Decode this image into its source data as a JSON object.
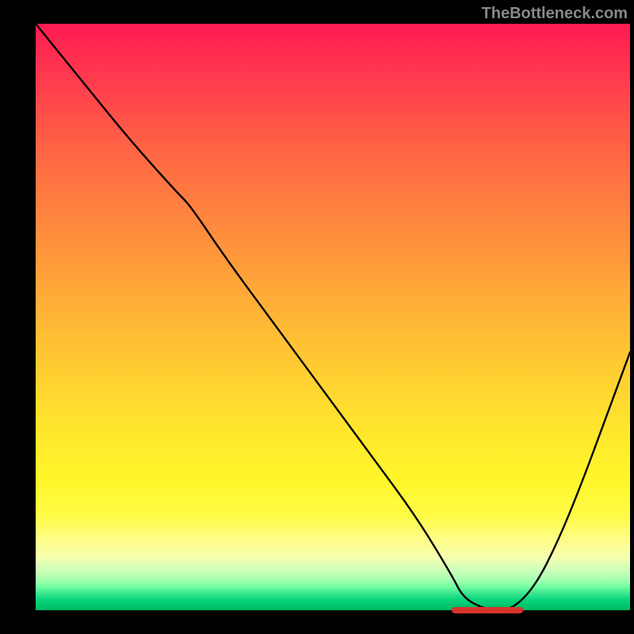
{
  "watermark": "TheBottleneck.com",
  "chart_data": {
    "type": "line",
    "title": "",
    "xlabel": "",
    "ylabel": "",
    "xlim": [
      0,
      100
    ],
    "ylim": [
      0,
      100
    ],
    "grid": false,
    "legend": false,
    "background_gradient": {
      "top": "#ff1a52",
      "middle": "#ffd430",
      "bottom": "#00b860"
    },
    "series": [
      {
        "name": "bottleneck-curve",
        "color": "#000000",
        "x": [
          0,
          8,
          16,
          24,
          26,
          32,
          40,
          48,
          56,
          64,
          70,
          72,
          76,
          80,
          84,
          88,
          92,
          96,
          100
        ],
        "y": [
          100,
          90,
          80,
          71,
          69,
          60,
          49,
          38,
          27,
          16,
          6,
          2,
          0,
          0,
          4,
          12,
          22,
          33,
          44
        ]
      }
    ],
    "annotations": [
      {
        "name": "optimal-range-marker",
        "x_start": 70,
        "x_end": 82,
        "y": 0,
        "color": "#d8332b"
      }
    ]
  }
}
